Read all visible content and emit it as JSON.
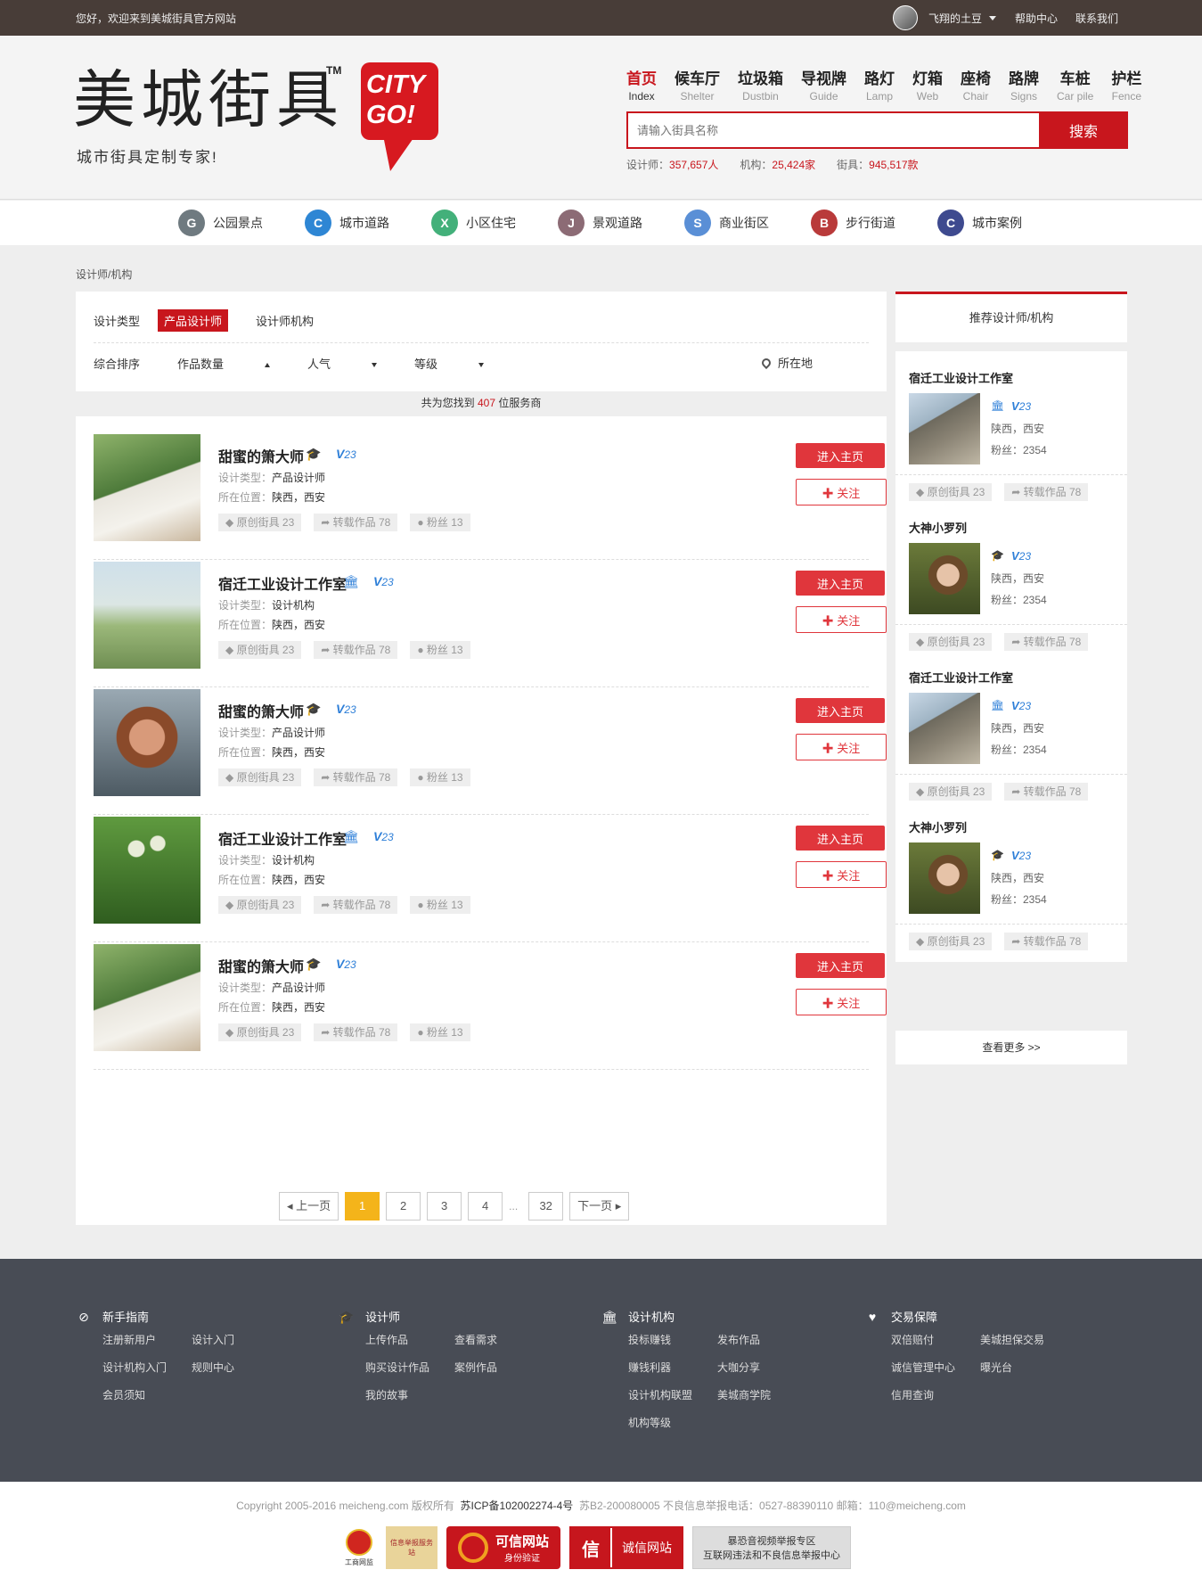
{
  "topbar": {
    "welcome": "您好，欢迎来到美城街具官方网站",
    "username": "飞翔的土豆",
    "help": "帮助中心",
    "contact": "联系我们"
  },
  "header": {
    "logo_text": "美城街具",
    "logo_tm": "TM",
    "logo_badge_line1": "CITY",
    "logo_badge_line2": "GO!",
    "slogan": "城市街具定制专家!",
    "nav": [
      {
        "cn": "首页",
        "en": "Index"
      },
      {
        "cn": "候车厅",
        "en": "Shelter"
      },
      {
        "cn": "垃圾箱",
        "en": "Dustbin"
      },
      {
        "cn": "导视牌",
        "en": "Guide"
      },
      {
        "cn": "路灯",
        "en": "Lamp"
      },
      {
        "cn": "灯箱",
        "en": "Web"
      },
      {
        "cn": "座椅",
        "en": "Chair"
      },
      {
        "cn": "路牌",
        "en": "Signs"
      },
      {
        "cn": "车桩",
        "en": "Car pile"
      },
      {
        "cn": "护栏",
        "en": "Fence"
      }
    ],
    "search_placeholder": "请输入街具名称",
    "search_button": "搜索",
    "stats": {
      "designer_label": "设计师：",
      "designer_value": "357,657人",
      "org_label": "机构：",
      "org_value": "25,424家",
      "furniture_label": "街具：",
      "furniture_value": "945,517款"
    }
  },
  "categories": [
    {
      "letter": "G",
      "label": "公园景点",
      "color": "#6f7a80"
    },
    {
      "letter": "C",
      "label": "城市道路",
      "color": "#2e86d4"
    },
    {
      "letter": "X",
      "label": "小区住宅",
      "color": "#43b07a"
    },
    {
      "letter": "J",
      "label": "景观道路",
      "color": "#8c6b75"
    },
    {
      "letter": "S",
      "label": "商业街区",
      "color": "#5a8fd6"
    },
    {
      "letter": "B",
      "label": "步行街道",
      "color": "#b93a3a"
    },
    {
      "letter": "C",
      "label": "城市案例",
      "color": "#3e4a8f"
    }
  ],
  "breadcrumb": "设计师/机构",
  "filter": {
    "type_label": "设计类型",
    "tabs": [
      "产品设计师",
      "设计师机构"
    ],
    "sorts": [
      "综合排序",
      "作品数量",
      "人气",
      "等级"
    ],
    "location": "所在地",
    "result_pre": "共为您找到",
    "result_count": "407",
    "result_post": "位服务商"
  },
  "list": [
    {
      "name": "甜蜜的箫大师",
      "kind": "designer",
      "v": "23",
      "type_label": "设计类型：",
      "type": "产品设计师",
      "loc_label": "所在位置：",
      "loc": "陕西，西安",
      "tag1": "原创街具 23",
      "tag2": "转载作品 78",
      "tag3": "粉丝 13"
    },
    {
      "name": "宿迁工业设计工作室",
      "kind": "org",
      "v": "23",
      "type_label": "设计类型：",
      "type": "设计机构",
      "loc_label": "所在位置：",
      "loc": "陕西，西安",
      "tag1": "原创街具 23",
      "tag2": "转载作品 78",
      "tag3": "粉丝 13"
    },
    {
      "name": "甜蜜的箫大师",
      "kind": "designer",
      "v": "23",
      "type_label": "设计类型：",
      "type": "产品设计师",
      "loc_label": "所在位置：",
      "loc": "陕西，西安",
      "tag1": "原创街具 23",
      "tag2": "转载作品 78",
      "tag3": "粉丝 13"
    },
    {
      "name": "宿迁工业设计工作室",
      "kind": "org",
      "v": "23",
      "type_label": "设计类型：",
      "type": "设计机构",
      "loc_label": "所在位置：",
      "loc": "陕西，西安",
      "tag1": "原创街具 23",
      "tag2": "转载作品 78",
      "tag3": "粉丝 13"
    },
    {
      "name": "甜蜜的箫大师",
      "kind": "designer",
      "v": "23",
      "type_label": "设计类型：",
      "type": "产品设计师",
      "loc_label": "所在位置：",
      "loc": "陕西，西安",
      "tag1": "原创街具 23",
      "tag2": "转载作品 78",
      "tag3": "粉丝 13"
    }
  ],
  "item_buttons": {
    "home": "进入主页",
    "follow": "关注"
  },
  "pager": {
    "prev": "上一页",
    "pages": [
      "1",
      "2",
      "3",
      "4"
    ],
    "dots": "...",
    "last": "32",
    "next": "下一页"
  },
  "sidebar": {
    "title": "推荐设计师/机构",
    "cards": [
      {
        "name": "宿迁工业设计工作室",
        "v": "23",
        "loc": "陕西，西安",
        "fans": "粉丝：2354",
        "tag1": "原创街具 23",
        "tag2": "转载作品 78"
      },
      {
        "name": "大神小罗列",
        "v": "23",
        "loc": "陕西，西安",
        "fans": "粉丝：2354",
        "tag1": "原创街具 23",
        "tag2": "转载作品 78"
      },
      {
        "name": "宿迁工业设计工作室",
        "v": "23",
        "loc": "陕西，西安",
        "fans": "粉丝：2354",
        "tag1": "原创街具 23",
        "tag2": "转载作品 78"
      },
      {
        "name": "大神小罗列",
        "v": "23",
        "loc": "陕西，西安",
        "fans": "粉丝：2354",
        "tag1": "原创街具 23",
        "tag2": "转载作品 78"
      }
    ],
    "see_more": "查看更多 >>"
  },
  "footer": {
    "cols": [
      {
        "title": "新手指南",
        "links": [
          "注册新用户",
          "设计入门",
          "设计机构入门",
          "规则中心",
          "会员须知"
        ]
      },
      {
        "title": "设计师",
        "links": [
          "上传作品",
          "查看需求",
          "购买设计作品",
          "案例作品",
          "我的故事"
        ]
      },
      {
        "title": "设计机构",
        "links": [
          "投标赚钱",
          "发布作品",
          "赚钱利器",
          "大咖分享",
          "设计机构联盟",
          "美城商学院",
          "机构等级"
        ]
      },
      {
        "title": "交易保障",
        "links": [
          "双倍赔付",
          "美城担保交易",
          "诚信管理中心",
          "曝光台",
          "信用查询"
        ]
      }
    ],
    "copyright": "Copyright 2005-2016 meicheng.com 版权所有",
    "icp": "苏ICP备102002274-4号",
    "report": "苏B2-200080005 不良信息举报电话：0527-88390110 邮箱：110@meicheng.com",
    "badges": {
      "b1": "工商网监",
      "b2": "信息举报服务站",
      "b3_line1": "可信网站",
      "b3_line2": "身份验证",
      "b4": "诚信网站",
      "b5_line1": "暴恐音视频举报专区",
      "b5_line2": "互联网违法和不良信息举报中心"
    }
  }
}
